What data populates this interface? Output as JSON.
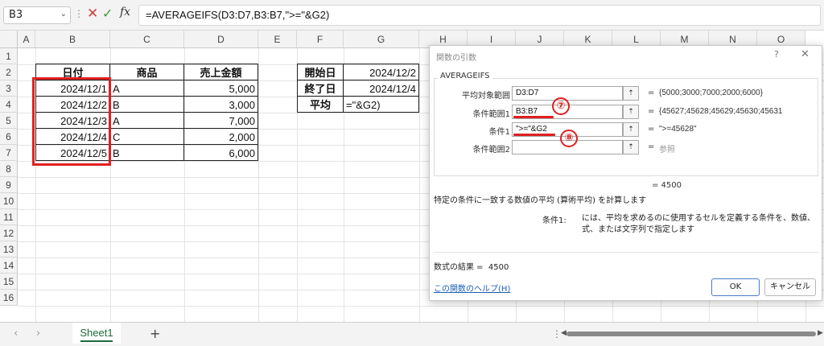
{
  "formula_bar": {
    "name_box": "B3",
    "formula": "=AVERAGEIFS(D3:D7,B3:B7,\">=\"&G2)"
  },
  "columns": [
    "A",
    "B",
    "C",
    "D",
    "E",
    "F",
    "G",
    "H",
    "I",
    "J",
    "K",
    "L",
    "M",
    "N",
    "O"
  ],
  "rows": [
    "1",
    "2",
    "3",
    "4",
    "5",
    "6",
    "7",
    "8",
    "9",
    "10",
    "11",
    "12",
    "13",
    "14",
    "15",
    "16"
  ],
  "table": {
    "headers": [
      "日付",
      "商品",
      "売上金額"
    ],
    "rows": [
      [
        "2024/12/1",
        "A",
        "5,000"
      ],
      [
        "2024/12/2",
        "B",
        "3,000"
      ],
      [
        "2024/12/3",
        "A",
        "7,000"
      ],
      [
        "2024/12/4",
        "C",
        "2,000"
      ],
      [
        "2024/12/5",
        "B",
        "6,000"
      ]
    ]
  },
  "criteria_table": {
    "start_label": "開始日",
    "start_value": "2024/12/2",
    "end_label": "終了日",
    "end_value": "2024/12/4",
    "avg_label": "平均",
    "avg_value": "=\"&G2)"
  },
  "dialog": {
    "title": "関数の引数",
    "help_icon": "?",
    "close_icon": "✕",
    "function_name": "AVERAGEIFS",
    "args": [
      {
        "label": "平均対象範囲",
        "value": "D3:D7",
        "result": "{5000;3000;7000;2000;6000}"
      },
      {
        "label": "条件範囲1",
        "value": "B3:B7",
        "result": "{45627;45628;45629;45630;45631"
      },
      {
        "label": "条件1",
        "value": "\">=\"&G2",
        "result": "\">=45628\""
      },
      {
        "label": "条件範囲2",
        "value": "",
        "result": "参照"
      }
    ],
    "formula_result_inline": "=    4500",
    "description": "特定の条件に一致する数値の平均 (算術平均) を計算します",
    "arg_desc_label": "条件1:",
    "arg_desc_text": "には、平均を求めるのに使用するセルを定義する条件を、数値、式、または文字列で指定します",
    "result_label": "数式の結果 =",
    "result_value": "4500",
    "help_link": "この関数のヘルプ(H)",
    "ok_label": "OK",
    "cancel_label": "キャンセル"
  },
  "annotations": {
    "marker_7": "⑦",
    "marker_8": "⑧",
    "highlight_color": "#e02020"
  },
  "sheet_tabs": {
    "active": "Sheet1",
    "add": "+"
  }
}
